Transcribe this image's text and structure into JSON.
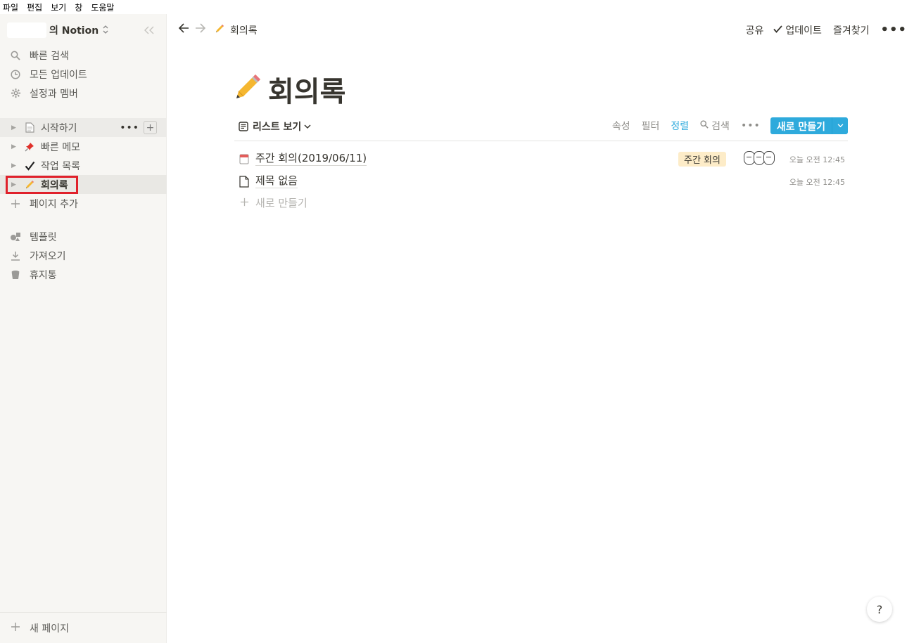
{
  "menubar": {
    "items": [
      "파일",
      "편집",
      "보기",
      "창",
      "도움말"
    ]
  },
  "sidebar": {
    "workspace_name": "의 Notion",
    "top_items": [
      {
        "label": "빠른 검색",
        "icon": "search-icon"
      },
      {
        "label": "모든 업데이트",
        "icon": "clock-icon"
      },
      {
        "label": "설정과 멤버",
        "icon": "gear-icon"
      }
    ],
    "pages": [
      {
        "label": "시작하기",
        "icon": "document-icon"
      },
      {
        "label": "빠른 메모",
        "icon": "pushpin-icon"
      },
      {
        "label": "작업 목록",
        "icon": "checkmark-icon"
      },
      {
        "label": "회의록",
        "icon": "pencil-icon"
      }
    ],
    "add_page": "페이지 추가",
    "bottom_items": [
      {
        "label": "템플릿",
        "icon": "shapes-icon"
      },
      {
        "label": "가져오기",
        "icon": "download-icon"
      },
      {
        "label": "휴지통",
        "icon": "trash-icon"
      }
    ],
    "new_page": "새 페이지"
  },
  "topbar": {
    "breadcrumb": "회의록",
    "share": "공유",
    "updates": "업데이트",
    "favorites": "즐겨찾기",
    "more": "•••"
  },
  "page": {
    "title": "회의록",
    "view_name": "리스트 보기",
    "tools": {
      "properties": "속성",
      "filter": "필터",
      "sort": "정렬",
      "search": "검색"
    },
    "new_button": "새로 만들기",
    "rows": [
      {
        "title": "주간 회의(2019/06/11)",
        "tag": "주간 회의",
        "time": "오늘 오전 12:45"
      },
      {
        "title": "제목 없음",
        "tag": "",
        "time": "오늘 오전 12:45"
      }
    ],
    "new_row": "새로 만들기"
  },
  "help": "?",
  "colors": {
    "accent": "#2eaadc",
    "sidebar_bg": "#f7f6f3",
    "tag_bg": "#fdecc8",
    "highlight_box": "#e0212b"
  }
}
